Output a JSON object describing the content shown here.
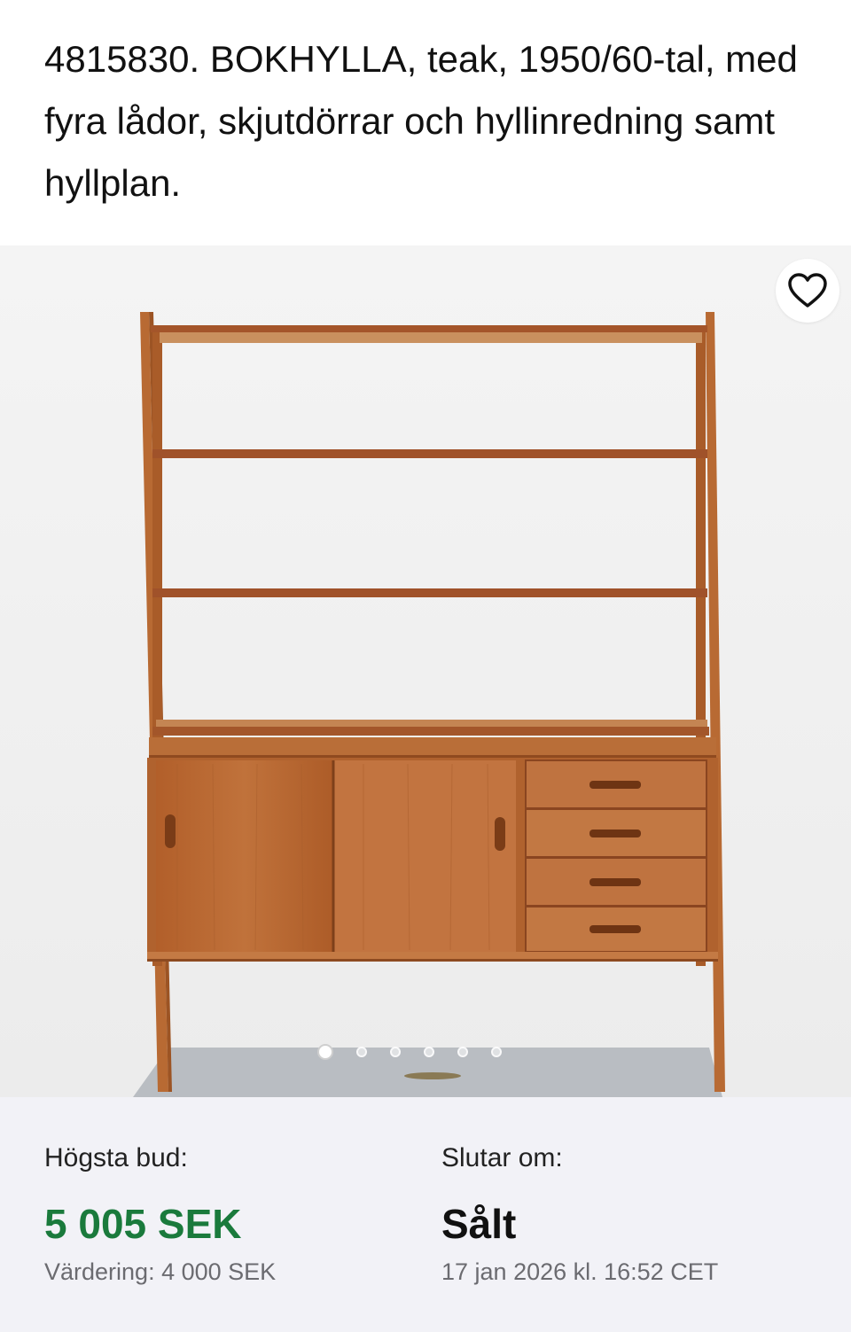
{
  "listing": {
    "title": "4815830. BOKHYLLA, teak, 1950/60-tal, med fyra lådor, skjutdörrar och hyllinredning samt hyllplan."
  },
  "gallery": {
    "image_count": 6,
    "active_index": 0,
    "favorite_icon": "heart-outline-icon"
  },
  "auction": {
    "highest_bid_label": "Högsta bud:",
    "highest_bid_value": "5 005 SEK",
    "estimate": "Värdering: 4 000 SEK",
    "ends_label": "Slutar om:",
    "ends_value": "Sålt",
    "end_date": "17 jan 2026 kl. 16:52 CET"
  },
  "colors": {
    "bid_green": "#1a7a3c",
    "info_background": "#f2f2f7",
    "teak": "#b5672f"
  }
}
